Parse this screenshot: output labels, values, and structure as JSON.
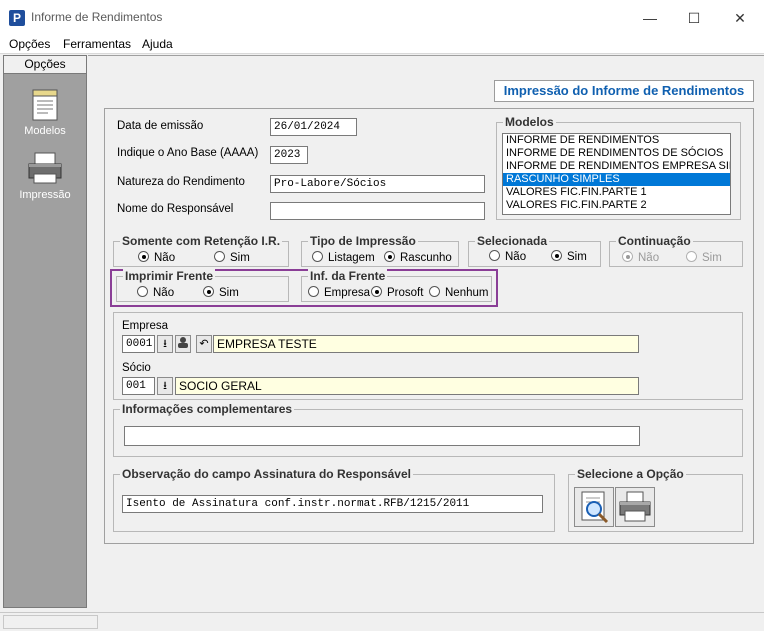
{
  "window": {
    "title": "Informe de Rendimentos",
    "app_icon_letter": "P"
  },
  "menu": {
    "items": [
      "Opções",
      "Ferramentas",
      "Ajuda"
    ]
  },
  "sidebar": {
    "header": "Opções",
    "items": [
      {
        "label": "Modelos",
        "icon": "document-icon"
      },
      {
        "label": "Impressão",
        "icon": "printer-icon"
      }
    ]
  },
  "header_label": "Impressão do Informe de Rendimentos",
  "form": {
    "data_emissao": {
      "label": "Data de emissão",
      "value": "26/01/2024"
    },
    "ano_base": {
      "label": "Indique o Ano Base (AAAA)",
      "value": "2023"
    },
    "natureza": {
      "label": "Natureza do Rendimento",
      "value": "Pro-Labore/Sócios"
    },
    "responsavel": {
      "label": "Nome do Responsável",
      "value": ""
    }
  },
  "modelos": {
    "title": "Modelos",
    "items": [
      "INFORME DE RENDIMENTOS",
      "INFORME DE RENDIMENTOS DE SÓCIOS",
      "INFORME DE RENDIMENTOS EMPRESA SIM",
      "RASCUNHO SIMPLES",
      "VALORES FIC.FIN.PARTE 1",
      "VALORES FIC.FIN.PARTE 2"
    ],
    "selected_index": 3
  },
  "groups": {
    "retencao": {
      "title": "Somente com Retenção I.R.",
      "options": [
        "Não",
        "Sim"
      ],
      "selected": "Não"
    },
    "tipo_impressao": {
      "title": "Tipo de Impressão",
      "options": [
        "Listagem",
        "Rascunho"
      ],
      "selected": "Rascunho"
    },
    "selecionada": {
      "title": "Selecionada",
      "options": [
        "Não",
        "Sim"
      ],
      "selected": "Sim"
    },
    "continuacao": {
      "title": "Continuação",
      "options": [
        "Não",
        "Sim"
      ],
      "selected": "Não",
      "disabled": true
    },
    "imprimir_frente": {
      "title": "Imprimir Frente",
      "options": [
        "Não",
        "Sim"
      ],
      "selected": "Sim"
    },
    "inf_frente": {
      "title": "Inf. da Frente",
      "options": [
        "Empresa",
        "Prosoft",
        "Nenhum"
      ],
      "selected": "Prosoft"
    }
  },
  "empresa": {
    "label": "Empresa",
    "code": "0001",
    "name": "EMPRESA TESTE"
  },
  "socio": {
    "label": "Sócio",
    "code": "001",
    "name": "SOCIO GERAL"
  },
  "info_complementares": {
    "title": "Informações complementares",
    "value": ""
  },
  "observacao": {
    "title": "Observação do campo Assinatura do Responsável",
    "value": "Isento de Assinatura conf.instr.normat.RFB/1215/2011"
  },
  "selecione": {
    "title": "Selecione a Opção"
  },
  "colors": {
    "header_text": "#1060b0",
    "selection": "#0078d7",
    "highlight_border": "#8a3e96",
    "sidebar": "#a0a0a0",
    "yellow_field": "#ffffe1"
  }
}
